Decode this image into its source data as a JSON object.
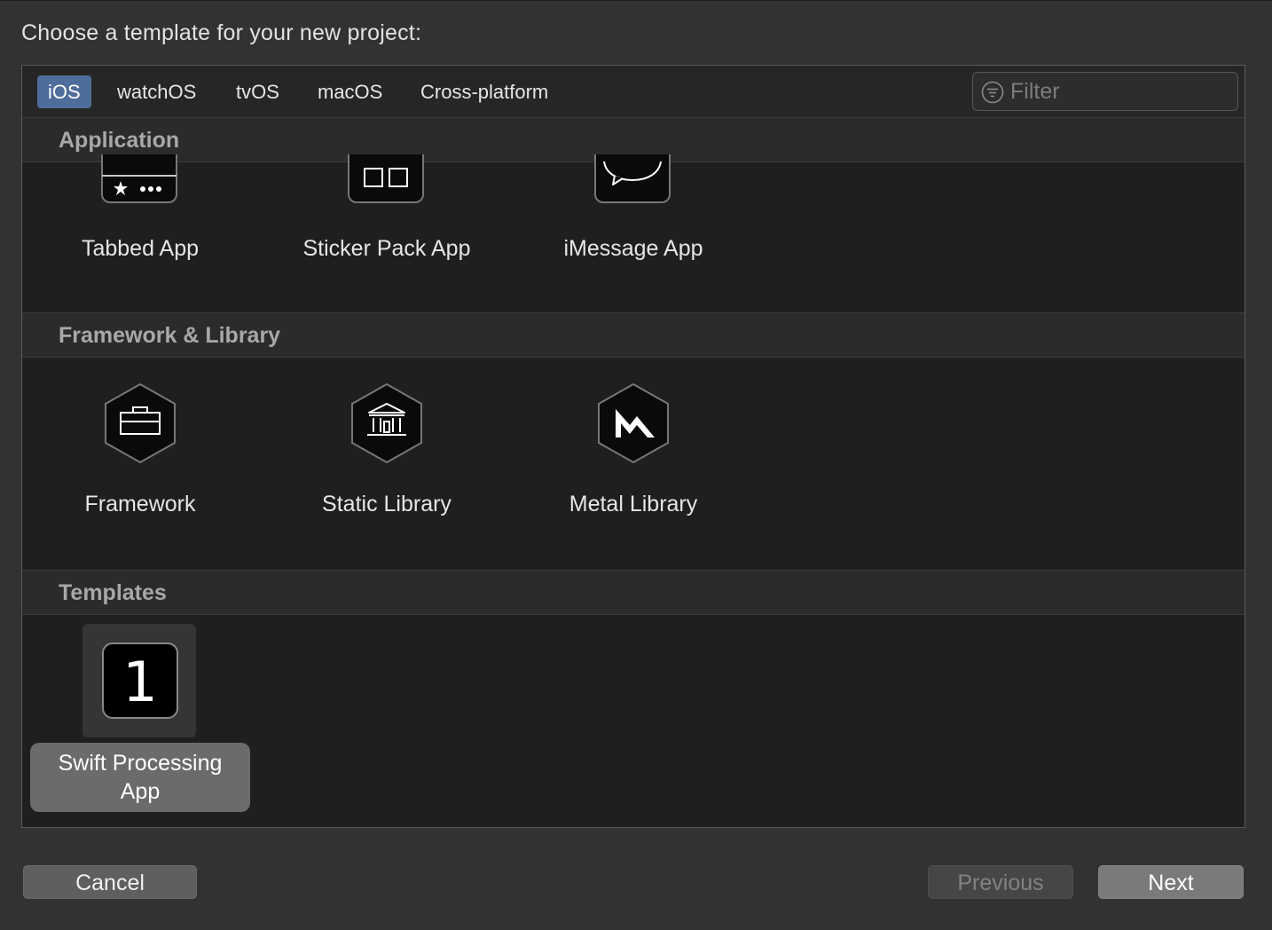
{
  "dialog": {
    "prompt": "Choose a template for your new project:"
  },
  "platform_tabs": [
    {
      "label": "iOS",
      "selected": true
    },
    {
      "label": "watchOS",
      "selected": false
    },
    {
      "label": "tvOS",
      "selected": false
    },
    {
      "label": "macOS",
      "selected": false
    },
    {
      "label": "Cross-platform",
      "selected": false
    }
  ],
  "filter": {
    "placeholder": "Filter",
    "value": "",
    "icon": "filter-icon"
  },
  "sections": [
    {
      "title": "Application",
      "items": [
        {
          "label": "Tabbed App",
          "icon": "tabbed-app-icon"
        },
        {
          "label": "Sticker Pack App",
          "icon": "sticker-pack-app-icon"
        },
        {
          "label": "iMessage App",
          "icon": "imessage-app-icon"
        }
      ]
    },
    {
      "title": "Framework & Library",
      "items": [
        {
          "label": "Framework",
          "icon": "framework-icon"
        },
        {
          "label": "Static Library",
          "icon": "static-library-icon"
        },
        {
          "label": "Metal Library",
          "icon": "metal-library-icon"
        }
      ]
    },
    {
      "title": "Templates",
      "items": [
        {
          "label": "Swift Processing App",
          "icon": "number-one-icon",
          "icon_text": "1",
          "selected": true
        }
      ]
    }
  ],
  "buttons": {
    "cancel": "Cancel",
    "previous": "Previous",
    "next": "Next",
    "previous_enabled": false
  },
  "colors": {
    "selected_tab": "#4f6d9a",
    "panel_bg": "#1f1f1f",
    "window_bg": "#323232"
  }
}
